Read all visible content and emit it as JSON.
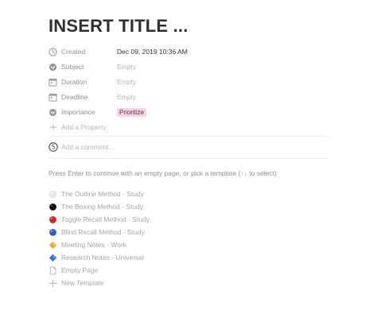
{
  "page": {
    "title": "INSERT TITLE ...",
    "properties": [
      {
        "icon": "clock-icon",
        "label": "Created",
        "value": "Dec 09, 2019 10:36 AM",
        "kind": "text"
      },
      {
        "icon": "select-icon",
        "label": "Subject",
        "value": "Empty",
        "kind": "empty"
      },
      {
        "icon": "calendar-icon",
        "label": "Duration",
        "value": "Empty",
        "kind": "empty"
      },
      {
        "icon": "calendar-icon",
        "label": "Deadline",
        "value": "Empty",
        "kind": "empty"
      },
      {
        "icon": "select-icon",
        "label": "Importance",
        "value": "Prioritize",
        "kind": "badge"
      }
    ],
    "add_property": "Add a Property",
    "comment_placeholder": "Add a comment...",
    "hint": "Press Enter to continue with an empty page, or pick a template (↑↓ to select)",
    "templates": [
      {
        "icon": "white-circle-icon",
        "label": "The Outline Method - Study",
        "color": "#e3e3e3"
      },
      {
        "icon": "black-circle-icon",
        "label": "The Boxing Method - Study",
        "color": "#111111"
      },
      {
        "icon": "red-circle-icon",
        "label": "Toggle Recall Method - Study",
        "color": "#d0241b"
      },
      {
        "icon": "blue-circle-icon",
        "label": "Blind Recall Method - Study",
        "color": "#2a5fc9"
      },
      {
        "icon": "orange-diamond-icon",
        "label": "Meeting Notes - Work",
        "color": "#f0a43a"
      },
      {
        "icon": "blue-diamond-icon",
        "label": "Research Notes - Universal",
        "color": "#2f6fd4"
      },
      {
        "icon": "page-icon",
        "label": "Empty Page"
      },
      {
        "icon": "plus-icon",
        "label": "New Template"
      }
    ],
    "accent_badge_bg": "#f7d4e6"
  }
}
